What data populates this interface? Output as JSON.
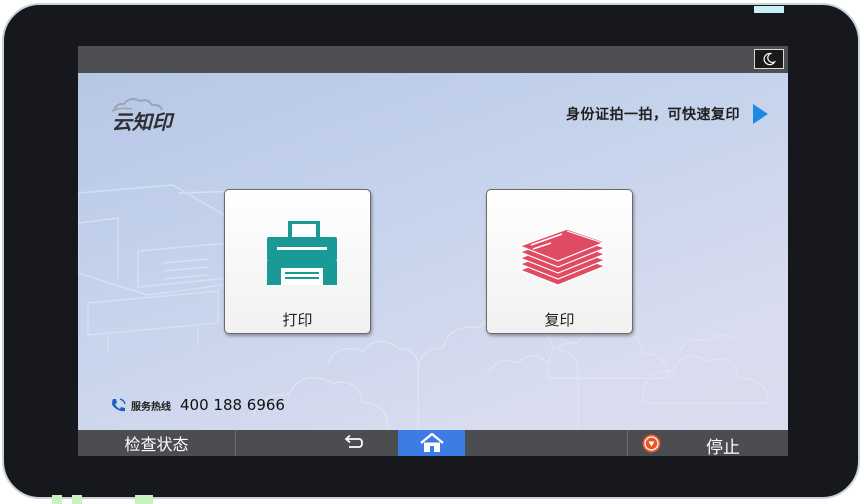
{
  "header": {
    "night_mode_icon": "moon-icon"
  },
  "brand": {
    "logo_text": "云知印"
  },
  "id_copy": {
    "label": "身份证拍一拍，可快速复印"
  },
  "tiles": [
    {
      "label": "打印",
      "icon": "printer-icon",
      "color": "#1a9a97"
    },
    {
      "label": "复印",
      "icon": "paper-stack-icon",
      "color": "#e04a63"
    }
  ],
  "hotline": {
    "label": "服务热线",
    "number": "400 188 6966",
    "icon": "phone-icon"
  },
  "bottom_bar": {
    "status_label": "检查状态",
    "back_icon": "back-arrow-icon",
    "home_icon": "home-icon",
    "home_active_color": "#3d7de3",
    "stop_label": "停止",
    "stop_icon": "stop-icon"
  }
}
